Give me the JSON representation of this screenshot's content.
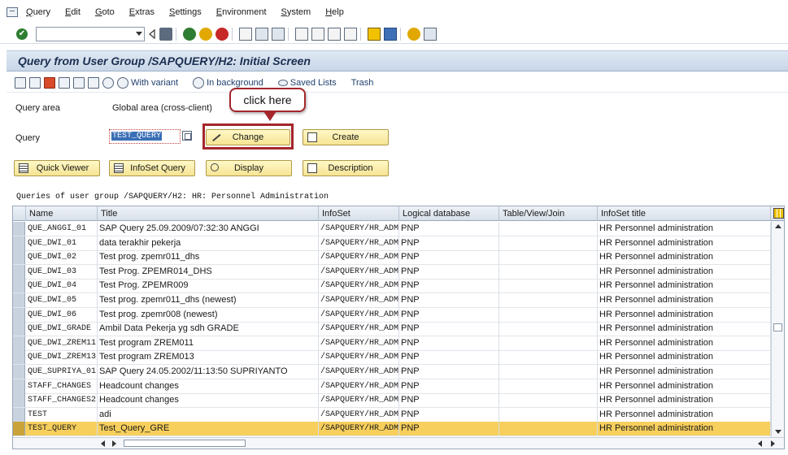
{
  "menu": [
    "Query",
    "Edit",
    "Goto",
    "Extras",
    "Settings",
    "Environment",
    "System",
    "Help"
  ],
  "title": "Query from User Group /SAPQUERY/H2: Initial Screen",
  "app_toolbar": {
    "with_variant": "With variant",
    "in_background": "In background",
    "saved_lists": "Saved Lists",
    "trash": "Trash"
  },
  "query_area": {
    "label": "Query area",
    "value": "Global area (cross-client)"
  },
  "query": {
    "label": "Query",
    "value": "TEST_QUERY"
  },
  "buttons": {
    "change": "Change",
    "create": "Create",
    "quick_viewer": "Quick Viewer",
    "infoset_query": "InfoSet Query",
    "display": "Display",
    "description": "Description"
  },
  "callout": "click here",
  "table": {
    "caption": "Queries of user group /SAPQUERY/H2: HR: Personnel Administration",
    "columns": [
      "Name",
      "Title",
      "InfoSet",
      "Logical database",
      "Table/View/Join",
      "InfoSet title"
    ],
    "rows": [
      [
        "QUE_ANGGI_01",
        "SAP Query 25.09.2009/07:32:30 ANGGI",
        "/SAPQUERY/HR_ADM",
        "PNP",
        "",
        "HR Personnel administration"
      ],
      [
        "QUE_DWI_01",
        "data terakhir pekerja",
        "/SAPQUERY/HR_ADM",
        "PNP",
        "",
        "HR Personnel administration"
      ],
      [
        "QUE_DWI_02",
        "Test prog. zpemr011_dhs",
        "/SAPQUERY/HR_ADM",
        "PNP",
        "",
        "HR Personnel administration"
      ],
      [
        "QUE_DWI_03",
        "Test Prog. ZPEMR014_DHS",
        "/SAPQUERY/HR_ADM",
        "PNP",
        "",
        "HR Personnel administration"
      ],
      [
        "QUE_DWI_04",
        "Test Prog. ZPEMR009",
        "/SAPQUERY/HR_ADM",
        "PNP",
        "",
        "HR Personnel administration"
      ],
      [
        "QUE_DWI_05",
        "Test prog. zpemr011_dhs (newest)",
        "/SAPQUERY/HR_ADM",
        "PNP",
        "",
        "HR Personnel administration"
      ],
      [
        "QUE_DWI_06",
        "Test prog. zpemr008 (newest)",
        "/SAPQUERY/HR_ADM",
        "PNP",
        "",
        "HR Personnel administration"
      ],
      [
        "QUE_DWI_GRADE",
        "Ambil Data Pekerja yg sdh GRADE",
        "/SAPQUERY/HR_ADM",
        "PNP",
        "",
        "HR Personnel administration"
      ],
      [
        "QUE_DWI_ZREM11",
        "Test program ZREM011",
        "/SAPQUERY/HR_ADM",
        "PNP",
        "",
        "HR Personnel administration"
      ],
      [
        "QUE_DWI_ZREM13",
        "Test program ZREM013",
        "/SAPQUERY/HR_ADM",
        "PNP",
        "",
        "HR Personnel administration"
      ],
      [
        "QUE_SUPRIYA_01",
        "SAP Query 24.05.2002/11:13:50 SUPRIYANTO",
        "/SAPQUERY/HR_ADM",
        "PNP",
        "",
        "HR Personnel administration"
      ],
      [
        "STAFF_CHANGES",
        "Headcount changes",
        "/SAPQUERY/HR_ADM",
        "PNP",
        "",
        "HR Personnel administration"
      ],
      [
        "STAFF_CHANGES2",
        "Headcount changes",
        "/SAPQUERY/HR_ADM",
        "PNP",
        "",
        "HR Personnel administration"
      ],
      [
        "TEST",
        "adi",
        "/SAPQUERY/HR_ADM",
        "PNP",
        "",
        "HR Personnel administration"
      ],
      [
        "TEST_QUERY",
        "Test_Query_GRE",
        "/SAPQUERY/HR_ADM",
        "PNP",
        "",
        "HR Personnel administration"
      ]
    ],
    "selected_row": "TEST_QUERY"
  },
  "colors": {
    "highlight_row": "#f7cf5c",
    "button_fill": "#f6e493",
    "annotation": "#a4262c"
  }
}
